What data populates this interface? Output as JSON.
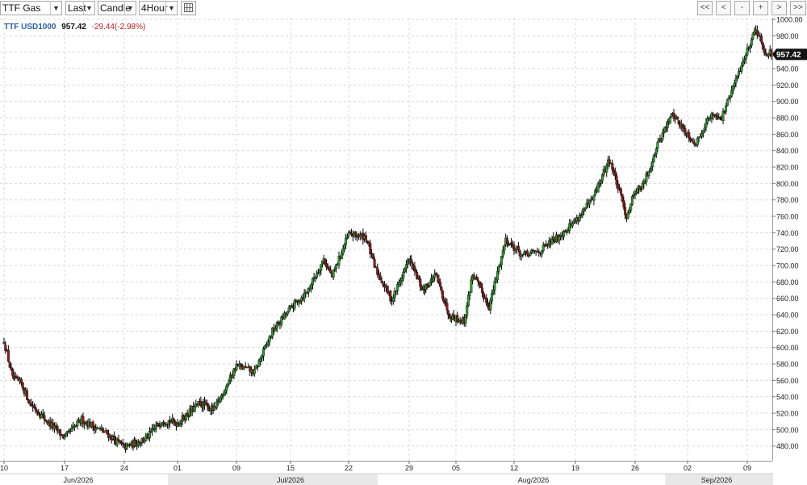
{
  "toolbar": {
    "instrument": "TTF Gas",
    "price_field": "Last",
    "chart_style": "Candle",
    "interval": "4Hour",
    "nav": [
      "<<",
      "<",
      "-",
      "+",
      ">",
      ">>"
    ]
  },
  "legend": {
    "symbol": "TTF USD1000",
    "last": "957.42",
    "change": "-29.44(-2.98%)"
  },
  "price_tag": "957.42",
  "colors": {
    "up": "#2e9b2e",
    "down": "#8b1a1a",
    "wick": "#000000",
    "grid": "#d8d8d8",
    "axis_band": "#e8e8e8",
    "legend_symbol": "#2b5ea7",
    "legend_change": "#b22222"
  },
  "chart_data": {
    "type": "candlestick",
    "title": "",
    "xlabel": "",
    "ylabel": "",
    "ylim": [
      462,
      1002
    ],
    "y_ticks": [
      480,
      500,
      520,
      540,
      560,
      580,
      600,
      620,
      640,
      660,
      680,
      700,
      720,
      740,
      760,
      780,
      800,
      820,
      840,
      860,
      880,
      900,
      920,
      940,
      960,
      980,
      1000
    ],
    "y_tick_labels": [
      "480.00",
      "500.00",
      "520.00",
      "540.00",
      "560.00",
      "580.00",
      "600.00",
      "620.00",
      "640.00",
      "660.00",
      "680.00",
      "700.00",
      "720.00",
      "740.00",
      "760.00",
      "780.00",
      "800.00",
      "820.00",
      "840.00",
      "860.00",
      "880.00",
      "900.00",
      "920.00",
      "940.00",
      "960.00",
      "980.00",
      "1000.00"
    ],
    "x_ticks": [
      {
        "label": "10",
        "date": "2026-06-10"
      },
      {
        "label": "17",
        "date": "2026-06-17"
      },
      {
        "label": "24",
        "date": "2026-06-24"
      },
      {
        "label": "01",
        "date": "2026-07-01"
      },
      {
        "label": "09",
        "date": "2026-07-09"
      },
      {
        "label": "15",
        "date": "2026-07-15"
      },
      {
        "label": "22",
        "date": "2026-07-22"
      },
      {
        "label": "29",
        "date": "2026-07-29"
      },
      {
        "label": "05",
        "date": "2026-08-05"
      },
      {
        "label": "12",
        "date": "2026-08-12"
      },
      {
        "label": "19",
        "date": "2026-08-19"
      },
      {
        "label": "26",
        "date": "2026-08-26"
      },
      {
        "label": "02",
        "date": "2026-09-02"
      },
      {
        "label": "09",
        "date": "2026-09-09"
      }
    ],
    "month_labels": [
      "Jun/2026",
      "Jul/2026",
      "Aug/2026",
      "Sep/2026"
    ],
    "grid": true,
    "series_anchors": [
      {
        "date": "2026-06-10",
        "close": 608
      },
      {
        "date": "2026-06-11",
        "close": 562
      },
      {
        "date": "2026-06-12",
        "close": 556
      },
      {
        "date": "2026-06-13",
        "close": 532
      },
      {
        "date": "2026-06-15",
        "close": 510
      },
      {
        "date": "2026-06-17",
        "close": 490
      },
      {
        "date": "2026-06-19",
        "close": 512
      },
      {
        "date": "2026-06-22",
        "close": 495
      },
      {
        "date": "2026-06-24",
        "close": 478
      },
      {
        "date": "2026-06-27",
        "close": 490
      },
      {
        "date": "2026-06-29",
        "close": 512
      },
      {
        "date": "2026-07-01",
        "close": 508
      },
      {
        "date": "2026-07-04",
        "close": 532
      },
      {
        "date": "2026-07-06",
        "close": 524
      },
      {
        "date": "2026-07-09",
        "close": 578
      },
      {
        "date": "2026-07-11",
        "close": 570
      },
      {
        "date": "2026-07-13",
        "close": 620
      },
      {
        "date": "2026-07-15",
        "close": 648
      },
      {
        "date": "2026-07-17",
        "close": 668
      },
      {
        "date": "2026-07-19",
        "close": 708
      },
      {
        "date": "2026-07-20",
        "close": 686
      },
      {
        "date": "2026-07-22",
        "close": 738
      },
      {
        "date": "2026-07-24",
        "close": 735
      },
      {
        "date": "2026-07-25",
        "close": 698
      },
      {
        "date": "2026-07-27",
        "close": 658
      },
      {
        "date": "2026-07-29",
        "close": 708
      },
      {
        "date": "2026-07-31",
        "close": 670
      },
      {
        "date": "2026-08-02",
        "close": 688
      },
      {
        "date": "2026-08-04",
        "close": 640
      },
      {
        "date": "2026-08-06",
        "close": 632
      },
      {
        "date": "2026-08-07",
        "close": 690
      },
      {
        "date": "2026-08-09",
        "close": 650
      },
      {
        "date": "2026-08-11",
        "close": 732
      },
      {
        "date": "2026-08-13",
        "close": 712
      },
      {
        "date": "2026-08-15",
        "close": 718
      },
      {
        "date": "2026-08-17",
        "close": 735
      },
      {
        "date": "2026-08-19",
        "close": 755
      },
      {
        "date": "2026-08-21",
        "close": 780
      },
      {
        "date": "2026-08-23",
        "close": 830
      },
      {
        "date": "2026-08-25",
        "close": 760
      },
      {
        "date": "2026-08-26",
        "close": 792
      },
      {
        "date": "2026-08-27",
        "close": 796
      },
      {
        "date": "2026-08-28",
        "close": 820
      },
      {
        "date": "2026-08-29",
        "close": 848
      },
      {
        "date": "2026-08-31",
        "close": 885
      },
      {
        "date": "2026-09-01",
        "close": 872
      },
      {
        "date": "2026-09-03",
        "close": 848
      },
      {
        "date": "2026-09-04",
        "close": 872
      },
      {
        "date": "2026-09-05",
        "close": 885
      },
      {
        "date": "2026-09-06",
        "close": 880
      },
      {
        "date": "2026-09-08",
        "close": 935
      },
      {
        "date": "2026-09-10",
        "close": 990
      },
      {
        "date": "2026-09-11",
        "close": 962
      },
      {
        "date": "2026-09-12",
        "close": 957
      }
    ],
    "gap": {
      "from": "2026-07-24",
      "to": "2026-07-25"
    }
  }
}
